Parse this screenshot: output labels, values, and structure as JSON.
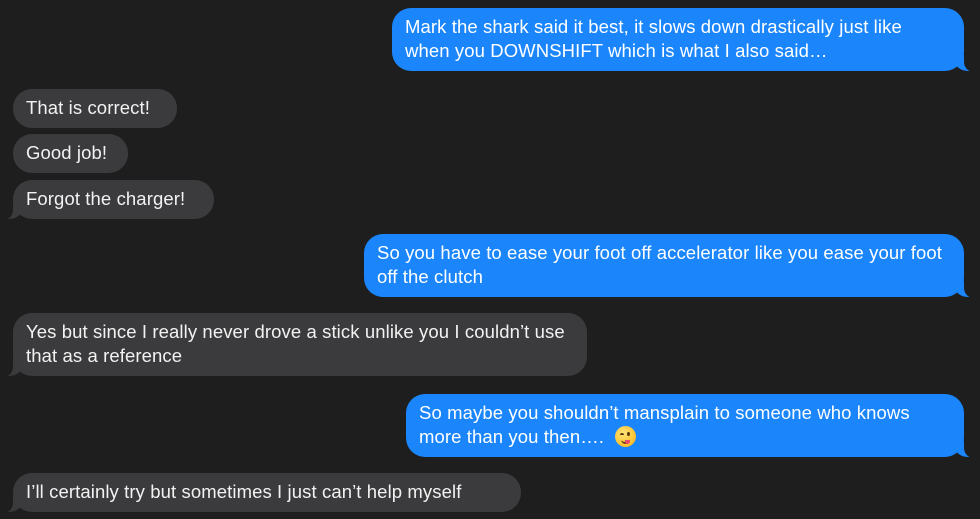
{
  "messages": [
    {
      "direction": "outgoing",
      "text": "Mark the shark said it best, it slows down drastically just like when you DOWNSHIFT which is what I also said…"
    },
    {
      "direction": "incoming",
      "text": "That is correct!"
    },
    {
      "direction": "incoming",
      "text": "Good job!"
    },
    {
      "direction": "incoming",
      "text": "Forgot the charger!"
    },
    {
      "direction": "outgoing",
      "text": "So you have to ease your foot off accelerator like you ease your foot off the clutch"
    },
    {
      "direction": "incoming",
      "text": "Yes but since I really never drove a stick unlike you I couldn’t use that as a reference"
    },
    {
      "direction": "outgoing",
      "text": "So maybe you shouldn’t mansplain to someone who knows more than you then….",
      "emoji": "winking-face-with-tongue"
    },
    {
      "direction": "incoming",
      "text": "I’ll certainly try but sometimes I just can’t help myself"
    }
  ],
  "colors": {
    "background": "#1e1e1e",
    "outgoing_bubble": "#1b86fb",
    "incoming_bubble": "#3b3b3d",
    "outgoing_text": "#ffffff",
    "incoming_text": "#f2f2f2"
  }
}
